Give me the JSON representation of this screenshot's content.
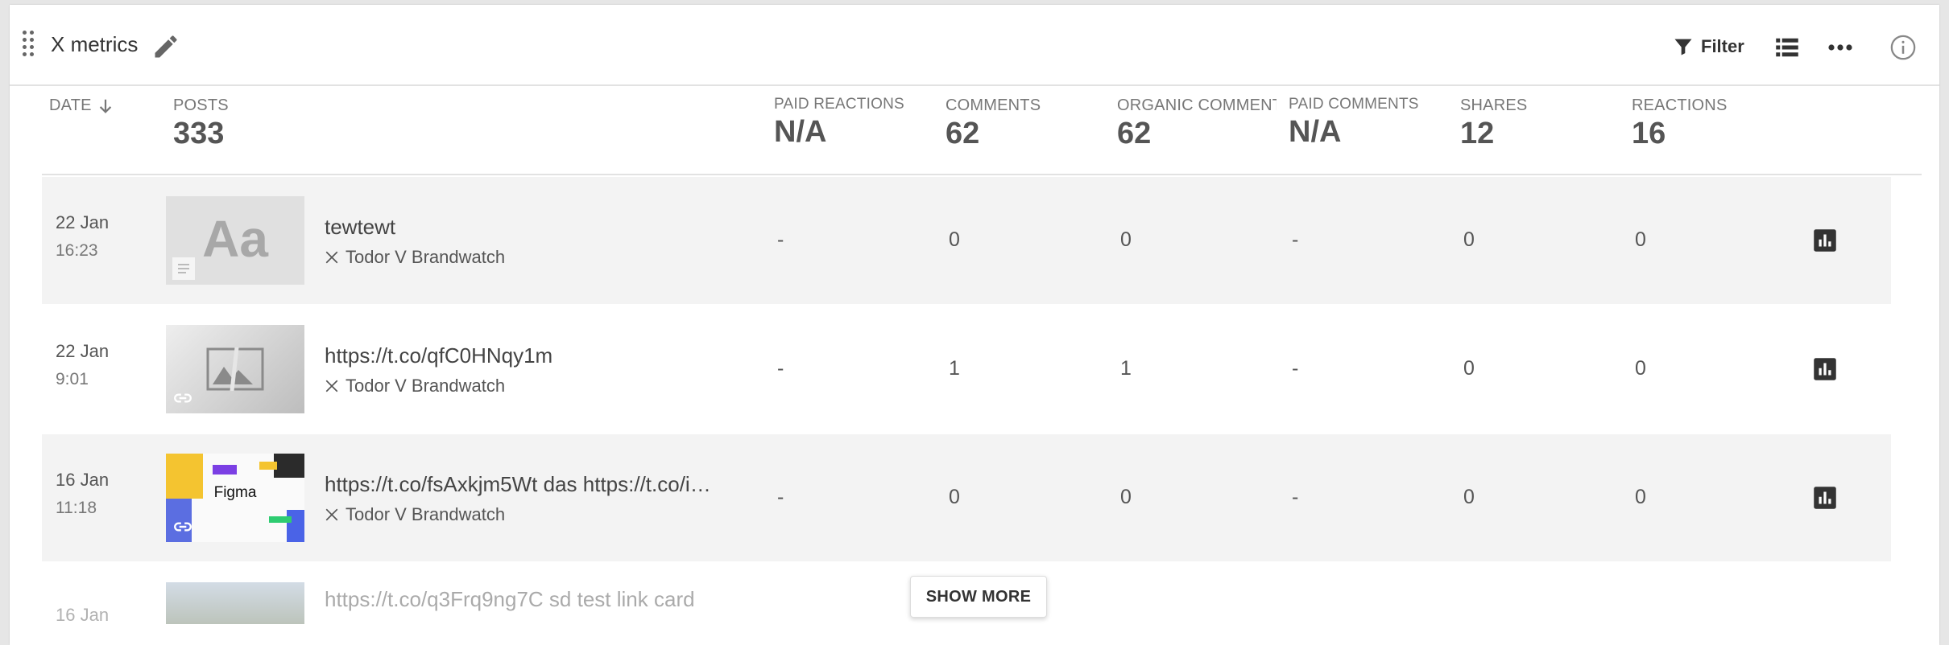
{
  "widget": {
    "title": "X metrics",
    "filter_label": "Filter",
    "show_more_label": "SHOW MORE"
  },
  "columns": [
    {
      "key": "date",
      "label": "DATE",
      "value": ""
    },
    {
      "key": "posts",
      "label": "POSTS",
      "value": "333"
    },
    {
      "key": "paid_reactions",
      "label": "PAID REACTIONS",
      "value": "N/A"
    },
    {
      "key": "comments",
      "label": "COMMENTS",
      "value": "62"
    },
    {
      "key": "organic_comments",
      "label": "ORGANIC COMMENTS",
      "value": "62"
    },
    {
      "key": "paid_comments",
      "label": "PAID COMMENTS",
      "value": "N/A"
    },
    {
      "key": "shares",
      "label": "SHARES",
      "value": "12"
    },
    {
      "key": "reactions",
      "label": "REACTIONS",
      "value": "16"
    }
  ],
  "rows": [
    {
      "date": "22 Jan",
      "time": "16:23",
      "title": "tewtewt",
      "author": "Todor V Brandwatch",
      "thumb": "text",
      "thumb_text": "Aa",
      "paid_reactions": "-",
      "comments": "0",
      "organic_comments": "0",
      "paid_comments": "-",
      "shares": "0",
      "reactions": "0"
    },
    {
      "date": "22 Jan",
      "time": "9:01",
      "title": "https://t.co/qfC0HNqy1m",
      "author": "Todor V Brandwatch",
      "thumb": "image-placeholder",
      "paid_reactions": "-",
      "comments": "1",
      "organic_comments": "1",
      "paid_comments": "-",
      "shares": "0",
      "reactions": "0"
    },
    {
      "date": "16 Jan",
      "time": "11:18",
      "title": "https://t.co/fsAxkjm5Wt das https://t.co/i…",
      "author": "Todor V Brandwatch",
      "thumb": "figma",
      "thumb_text": "Figma",
      "paid_reactions": "-",
      "comments": "0",
      "organic_comments": "0",
      "paid_comments": "-",
      "shares": "0",
      "reactions": "0"
    },
    {
      "date": "16 Jan",
      "time": "",
      "title": "https://t.co/q3Frq9ng7C sd test link card",
      "author": "",
      "thumb": "photo",
      "paid_reactions": "",
      "comments": "",
      "organic_comments": "",
      "paid_comments": "",
      "shares": "",
      "reactions": ""
    }
  ],
  "colors": {
    "row_shade": "#f3f3f3",
    "icon_dark": "#333333",
    "text_muted": "#777777"
  }
}
